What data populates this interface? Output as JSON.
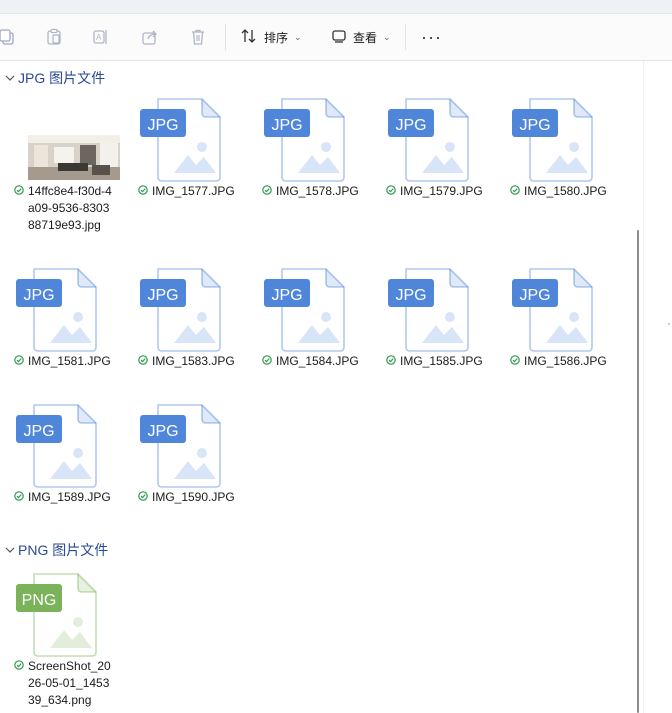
{
  "toolbar": {
    "sort_label": "排序",
    "view_label": "查看",
    "more_label": "···",
    "icons": [
      "copy-icon",
      "paste-icon",
      "rename-icon",
      "share-icon",
      "delete-icon",
      "sort-icon",
      "view-icon"
    ]
  },
  "groups": [
    {
      "header": "JPG 图片文件",
      "items": [
        {
          "name": "14ffc8e4-f30d-4a09-9536-830388719e93.jpg",
          "kind": "photo"
        },
        {
          "name": "IMG_1577.JPG",
          "kind": "jpg"
        },
        {
          "name": "IMG_1578.JPG",
          "kind": "jpg"
        },
        {
          "name": "IMG_1579.JPG",
          "kind": "jpg"
        },
        {
          "name": "IMG_1580.JPG",
          "kind": "jpg"
        },
        {
          "name": "IMG_1581.JPG",
          "kind": "jpg"
        },
        {
          "name": "IMG_1583.JPG",
          "kind": "jpg"
        },
        {
          "name": "IMG_1584.JPG",
          "kind": "jpg"
        },
        {
          "name": "IMG_1585.JPG",
          "kind": "jpg"
        },
        {
          "name": "IMG_1586.JPG",
          "kind": "jpg"
        },
        {
          "name": "IMG_1589.JPG",
          "kind": "jpg"
        },
        {
          "name": "IMG_1590.JPG",
          "kind": "jpg"
        }
      ]
    },
    {
      "header": "PNG 图片文件",
      "items": [
        {
          "name": "ScreenShot_2026-05-01_145339_634.png",
          "kind": "png"
        }
      ]
    }
  ],
  "file_icon_labels": {
    "jpg": "JPG",
    "png": "PNG"
  },
  "colors": {
    "jpg_accent": "#4f86d9",
    "png_accent": "#7bb35a",
    "header_text": "#2a4a96",
    "sync_check": "#2e9b4f"
  }
}
